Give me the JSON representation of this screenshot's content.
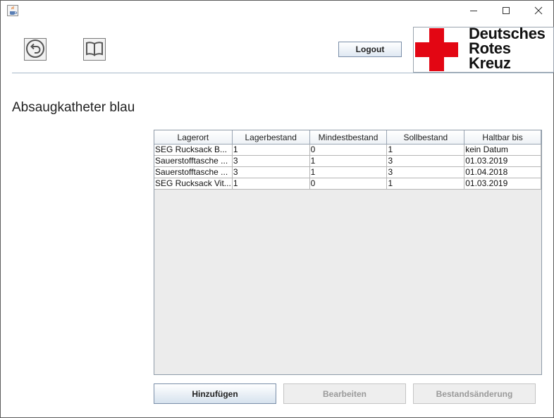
{
  "window": {
    "app_icon": "java-cup-icon",
    "controls": [
      "minimize-icon",
      "maximize-icon",
      "close-icon"
    ]
  },
  "toolbar": {
    "back_icon": "back-arrow-icon",
    "manual_icon": "open-book-icon",
    "logout_label": "Logout"
  },
  "logo": {
    "lines": [
      "Deutsches",
      "Rotes",
      "Kreuz"
    ],
    "cross_color": "#e30613"
  },
  "page": {
    "title": "Absaugkatheter blau"
  },
  "table": {
    "columns": [
      "Lagerort",
      "Lagerbestand",
      "Mindestbestand",
      "Sollbestand",
      "Haltbar bis"
    ],
    "rows": [
      [
        "SEG Rucksack B...",
        "1",
        "0",
        "1",
        "kein Datum"
      ],
      [
        "Sauerstofftasche ...",
        "3",
        "1",
        "3",
        "01.03.2019"
      ],
      [
        "Sauerstofftasche ...",
        "3",
        "1",
        "3",
        "01.04.2018"
      ],
      [
        "SEG Rucksack Vit...",
        "1",
        "0",
        "1",
        "01.03.2019"
      ]
    ]
  },
  "actions": {
    "add_label": "Hinzufügen",
    "edit_label": "Bearbeiten",
    "stock_change_label": "Bestandsänderung"
  }
}
